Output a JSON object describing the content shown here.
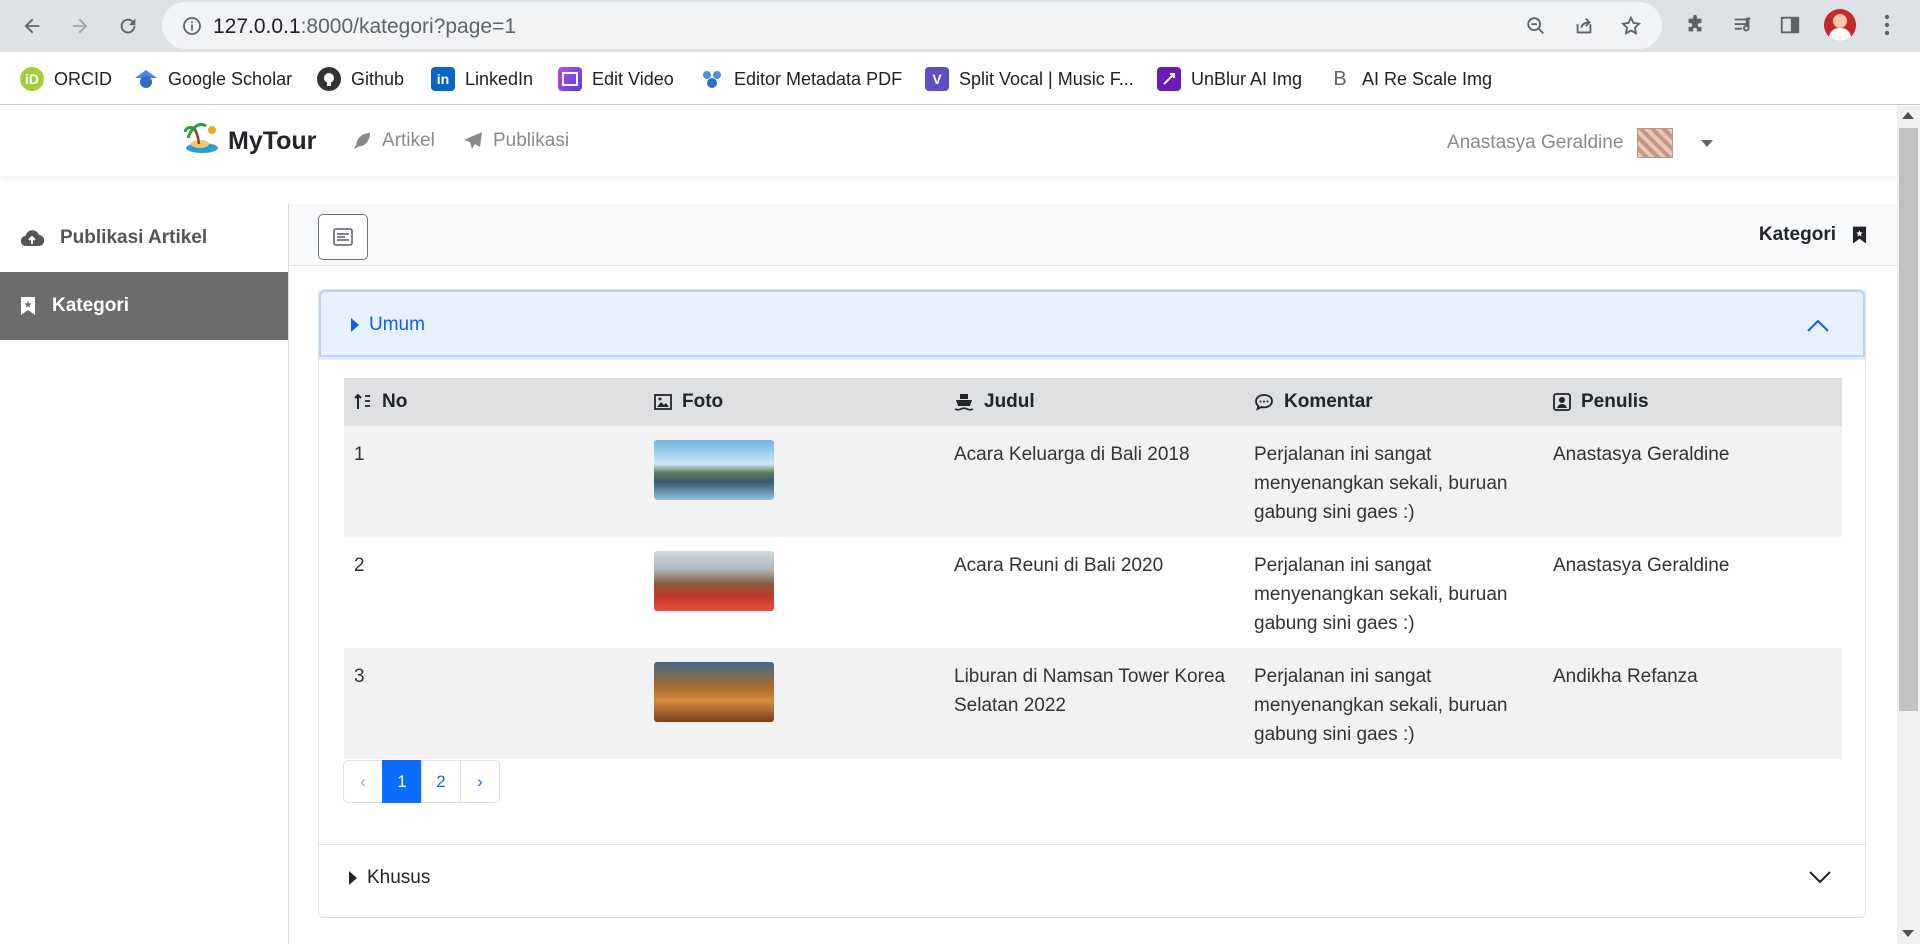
{
  "browser": {
    "url_host": "127.0.0.1",
    "url_rest": ":8000/kategori?page=1",
    "bookmarks": [
      {
        "label": "ORCID",
        "icon": "orcid-icon",
        "color": "#a6ce39"
      },
      {
        "label": "Google Scholar",
        "icon": "google-scholar-icon",
        "color": "#4285f4"
      },
      {
        "label": "Github",
        "icon": "github-icon",
        "color": "#333333"
      },
      {
        "label": "LinkedIn",
        "icon": "linkedin-icon",
        "color": "#0a66c2"
      },
      {
        "label": "Edit Video",
        "icon": "edit-video-icon",
        "color": "#7b3fe4"
      },
      {
        "label": "Editor Metadata PDF",
        "icon": "editor-metadata-icon",
        "color": "#4a90e2"
      },
      {
        "label": "Split Vocal | Music F...",
        "icon": "split-vocal-icon",
        "color": "#5b4fc4"
      },
      {
        "label": "UnBlur AI Img",
        "icon": "unblur-icon",
        "color": "#6a1bb5"
      },
      {
        "label": "AI Re Scale Img",
        "icon": "rescale-icon",
        "color": "#777777"
      }
    ]
  },
  "navbar": {
    "brand": "MyTour",
    "links": [
      {
        "label": "Artikel",
        "icon": "feather-icon"
      },
      {
        "label": "Publikasi",
        "icon": "paper-plane-icon"
      }
    ],
    "user_name": "Anastasya Geraldine"
  },
  "sidebar": {
    "items": [
      {
        "label": "Publikasi Artikel",
        "icon": "cloud-upload-icon",
        "active": false
      },
      {
        "label": "Kategori",
        "icon": "bookmark-icon",
        "active": true
      }
    ]
  },
  "header": {
    "title": "Kategori"
  },
  "accordion": {
    "open_section": "Umum",
    "closed_section": "Khusus"
  },
  "table": {
    "headers": [
      {
        "label": "No",
        "icon": "sort-icon"
      },
      {
        "label": "Foto",
        "icon": "image-icon"
      },
      {
        "label": "Judul",
        "icon": "ship-icon"
      },
      {
        "label": "Komentar",
        "icon": "comment-icon"
      },
      {
        "label": "Penulis",
        "icon": "user-portrait-icon"
      }
    ],
    "rows": [
      {
        "no": "1",
        "judul": "Acara Keluarga di Bali 2018",
        "komentar": "Perjalanan ini sangat menyenangkan sekali, buruan gabung sini gaes :)",
        "penulis": "Anastasya Geraldine"
      },
      {
        "no": "2",
        "judul": "Acara Reuni di Bali 2020",
        "komentar": "Perjalanan ini sangat menyenangkan sekali, buruan gabung sini gaes :)",
        "penulis": "Anastasya Geraldine"
      },
      {
        "no": "3",
        "judul": "Liburan di Namsan Tower Korea Selatan 2022",
        "komentar": "Perjalanan ini sangat menyenangkan sekali, buruan gabung sini gaes :)",
        "penulis": "Andikha Refanza"
      }
    ]
  },
  "pagination": {
    "prev": "‹",
    "pages": [
      "1",
      "2"
    ],
    "current": "1",
    "next": "›"
  },
  "colors": {
    "accent": "#0d6efd",
    "sidebar_active": "#6b6c6b",
    "accordion_open_bg": "#e7f1ff"
  }
}
